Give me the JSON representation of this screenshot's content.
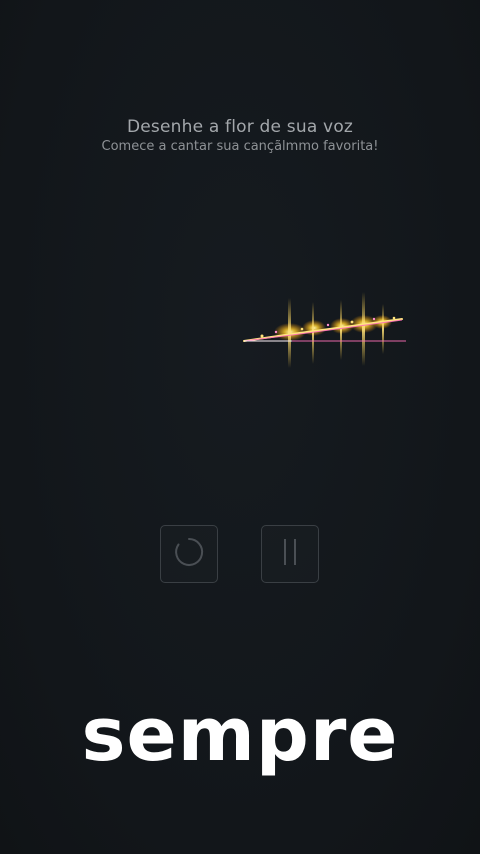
{
  "header": {
    "title": "Desenhe a flor de sua voz",
    "subtitle": "Comece a cantar sua cançãlmmo favorita!"
  },
  "controls": {
    "reset_icon": "circular-reset-icon",
    "pause_icon": "pause-icon",
    "border_color": "#3a3f44"
  },
  "caption": {
    "text": "sempre"
  },
  "colors": {
    "background": "#13171b",
    "flower_glow": "#ffd23a",
    "flower_line": "#ff5fb0"
  }
}
